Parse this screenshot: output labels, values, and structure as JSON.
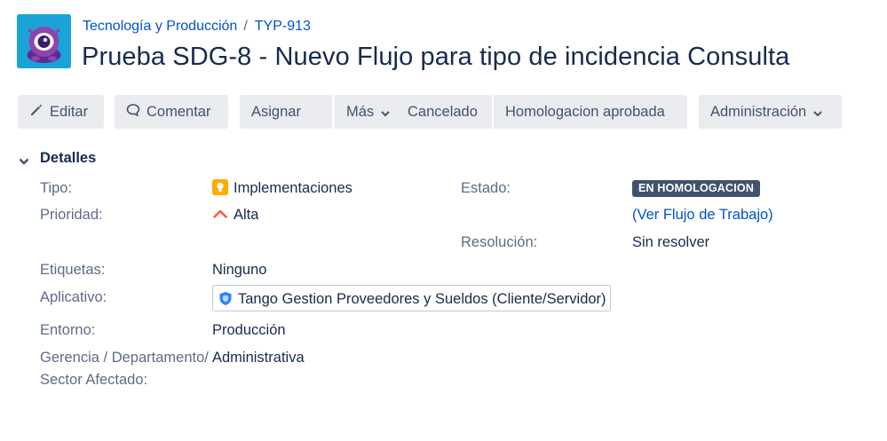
{
  "breadcrumb": {
    "project": "Tecnología y Producción",
    "separator": "/",
    "issue_key": "TYP-913"
  },
  "issue": {
    "title": "Prueba SDG-8 - Nuevo Flujo para tipo de incidencia Consulta"
  },
  "toolbar": {
    "edit": "Editar",
    "comment": "Comentar",
    "assign": "Asignar",
    "more": "Más",
    "cancelled": "Cancelado",
    "homologation_approved": "Homologacion aprobada",
    "administration": "Administración"
  },
  "details": {
    "section_label": "Detalles",
    "type_label": "Tipo:",
    "type_value": "Implementaciones",
    "priority_label": "Prioridad:",
    "priority_value": "Alta",
    "status_label": "Estado:",
    "status_value": "EN HOMOLOGACION",
    "workflow_open": "(",
    "workflow_link": "Ver Flujo de Trabajo",
    "workflow_close": ")",
    "resolution_label": "Resolución:",
    "resolution_value": "Sin resolver",
    "labels_label": "Etiquetas:",
    "labels_value": "Ninguno",
    "app_label": "Aplicativo:",
    "app_value": "Tango Gestion Proveedores y Sueldos (Cliente/Servidor)",
    "environment_label": "Entorno:",
    "environment_value": "Producción",
    "management_label": "Gerencia / Departamento/ Sector Afectado:",
    "management_value": "Administrativa"
  },
  "colors": {
    "link": "#0052cc",
    "button_bg": "#ebecf0",
    "status_lozenge": "#42526e",
    "priority_high": "#ff5630",
    "type_icon": "#ffab00",
    "avatar_bg": "#1aa3d6"
  },
  "icons": {
    "avatar": "project-avatar-monster",
    "edit": "pencil-icon",
    "comment": "comment-bubble-icon",
    "dropdown": "chevron-down-icon",
    "section_toggle": "chevron-down-icon",
    "type": "lightbulb-icon",
    "priority": "arrow-up-icon",
    "app": "shield-icon"
  }
}
